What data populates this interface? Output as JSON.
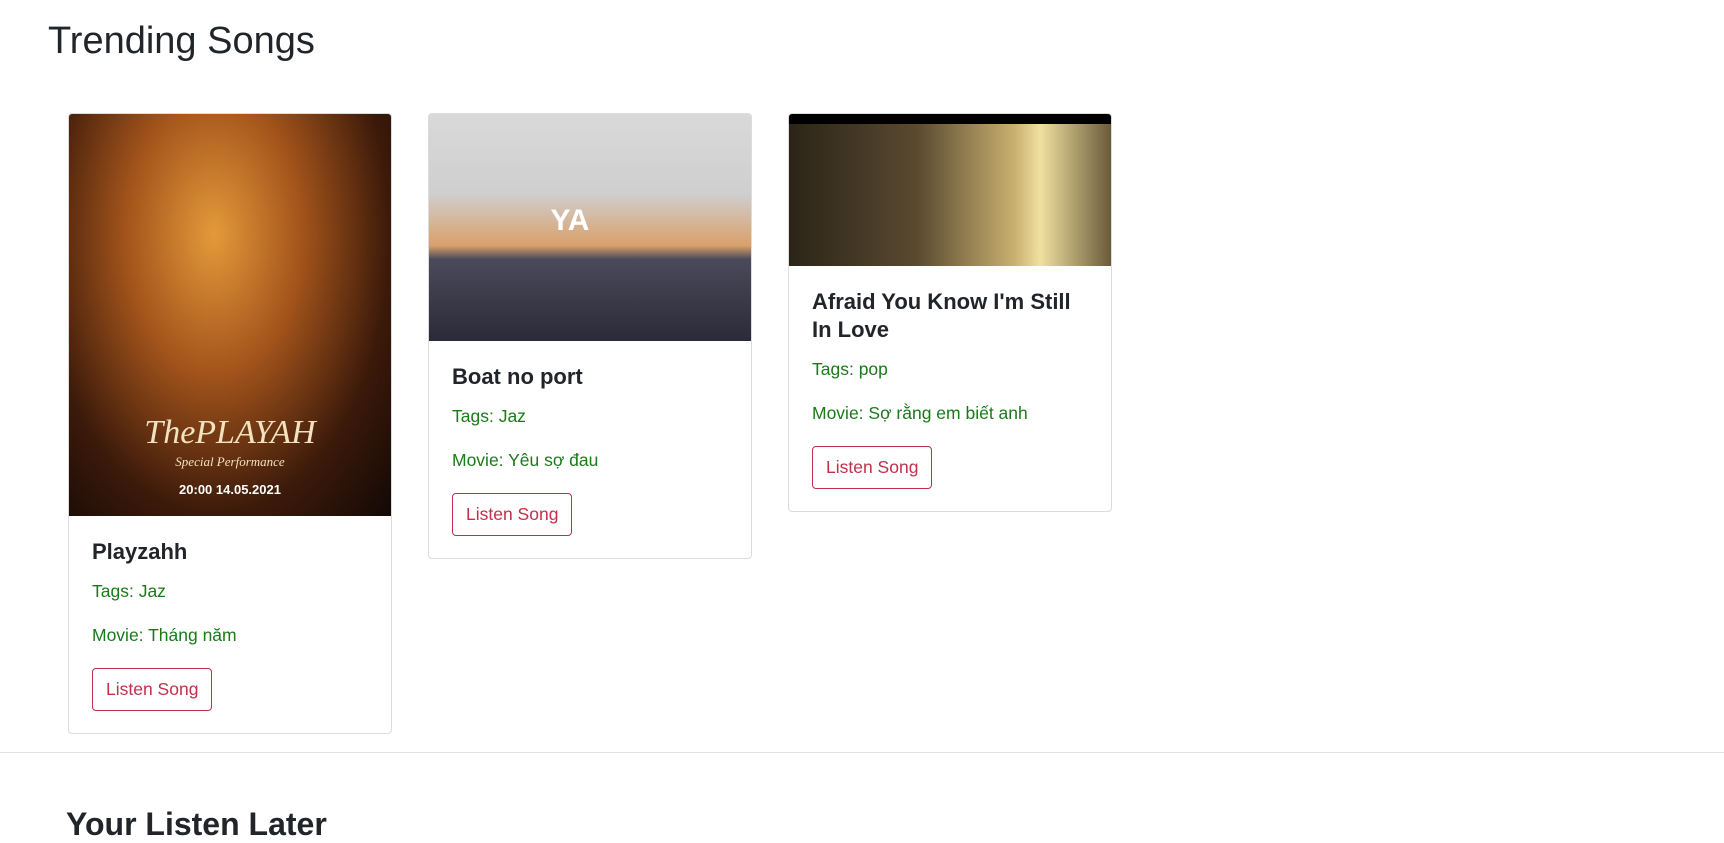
{
  "page": {
    "title": "Trending Songs",
    "section2_title": "Your Listen Later"
  },
  "songs": [
    {
      "title": "Playzahh",
      "tags": "Tags: Jaz",
      "movie": "Movie: Tháng năm",
      "button": "Listen Song",
      "poster": {
        "title": "ThePLAYAH",
        "subtitle": "Special Performance",
        "date": "20:00 14.05.2021"
      }
    },
    {
      "title": "Boat no port",
      "tags": "Tags: Jaz",
      "movie": "Movie: Yêu sợ đau",
      "button": "Listen Song",
      "logo": "YA"
    },
    {
      "title": "Afraid You Know I'm Still In Love",
      "tags": "Tags: pop",
      "movie": "Movie: Sợ rằng em biết anh",
      "button": "Listen Song"
    }
  ],
  "colors": {
    "tag_text": "#1a7a1a",
    "button_outline": "#c0304a"
  }
}
